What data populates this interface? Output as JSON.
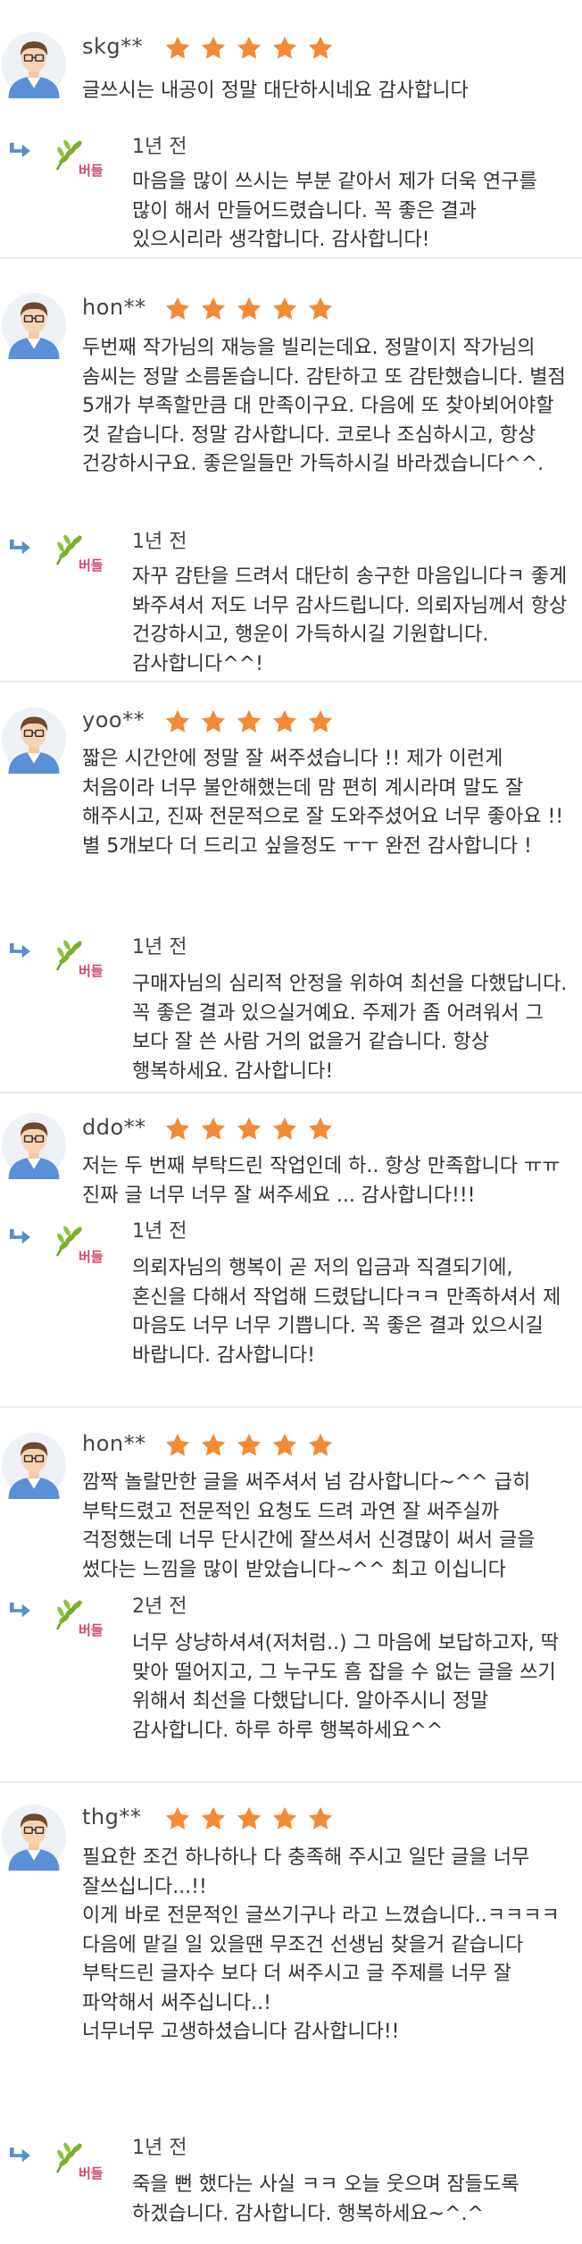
{
  "colors": {
    "star": "#f28a36",
    "seller_label": "#d4476b",
    "reply_arrow": "#5b8dd1",
    "divider": "#ececec"
  },
  "icons": {
    "avatar": "user-avatar-icon",
    "star": "star-icon",
    "reply": "reply-arrow-icon",
    "seller": "leaf-seller-icon"
  },
  "reviews": [
    {
      "user": "skg**",
      "rating": 5,
      "text": "글쓰시는 내공이 정말 대단하시네요 감사합니다",
      "reply_date": "1년 전",
      "seller_label": "버들",
      "reply": "마음을 많이 쓰시는 부분 같아서 제가 더욱 연구를 많이 해서 만들어드렸습니다. 꼭 좋은 결과 있으시리라 생각합니다. 감사합니다!"
    },
    {
      "user": "hon**",
      "rating": 5,
      "text": "두번째 작가님의 재능을 빌리는데요. 정말이지 작가님의 솜씨는 정말 소름돋습니다. 감탄하고 또 감탄했습니다. 별점 5개가 부족할만큼 대 만족이구요. 다음에 또 찾아뵈어야할 것 같습니다. 정말 감사합니다. 코로나 조심하시고, 항상 건강하시구요. 좋은일들만 가득하시길 바라겠습니다^^.",
      "reply_date": "1년 전",
      "seller_label": "버들",
      "reply": "자꾸 감탄을 드려서 대단히 송구한 마음입니다ㅋ 좋게 봐주셔서 저도 너무 감사드립니다. 의뢰자님께서 항상 건강하시고, 행운이 가득하시길 기원합니다. 감사합니다^^!"
    },
    {
      "user": "yoo**",
      "rating": 5,
      "text": "짧은 시간안에 정말 잘 써주셨습니다 !! 제가 이런게 처음이라 너무 불안해했는데 맘 편히 계시라며 말도 잘 해주시고, 진짜 전문적으로 잘 도와주셨어요 너무 좋아요 !! 별 5개보다 더 드리고 싶을정도 ㅜㅜ 완전 감사합니다 !",
      "reply_date": "1년 전",
      "seller_label": "버들",
      "reply": "구매자님의 심리적 안정을 위하여 최선을 다했답니다. 꼭 좋은 결과 있으실거예요. 주제가 좀 어려워서 그 보다 잘 쓴 사람 거의 없을거 같습니다. 항상 행복하세요. 감사합니다!"
    },
    {
      "user": "ddo**",
      "rating": 5,
      "text": "저는 두 번째 부탁드린 작업인데 하.. 항상 만족합니다 ㅠㅠ 진짜 글 너무 너무 잘 써주세요 ... 감사합니다!!!",
      "reply_date": "1년 전",
      "seller_label": "버들",
      "reply": "의뢰자님의 행복이 곧 저의 입금과 직결되기에, 혼신을 다해서 작업해 드렸답니다ㅋㅋ 만족하셔서 제 마음도 너무 너무 기쁩니다. 꼭 좋은 결과 있으시길 바랍니다. 감사합니다!"
    },
    {
      "user": "hon**",
      "rating": 5,
      "text": "깜짝 놀랄만한 글을 써주셔서 넘 감사합니다~^^ 급히 부탁드렸고 전문적인 요청도 드려 과연 잘 써주실까 걱정했는데 너무 단시간에 잘쓰셔서 신경많이 써서 글을 썼다는 느낌을 많이 받았습니다~^^ 최고 이십니다",
      "reply_date": "2년 전",
      "seller_label": "버들",
      "reply": "너무 상냥하셔셔(저처럼..) 그 마음에 보답하고자, 딱 맞아 떨어지고, 그 누구도 흠 잡을 수 없는 글을 쓰기 위해서 최선을 다했답니다. 알아주시니 정말 감사합니다. 하루 하루 행복하세요^^"
    },
    {
      "user": "thg**",
      "rating": 5,
      "text": "필요한 조건 하나하나 다 충족해 주시고 일단 글을 너무 잘쓰십니다...!!\n이게 바로 전문적인 글쓰기구나 라고 느꼈습니다..ㅋㅋㅋㅋ\n다음에 맡길 일 있을땐 무조건 선생님 찾을거 같습니다 부탁드린 글자수 보다 더 써주시고 글 주제를 너무 잘 파악해서 써주십니다..!\n너무너무 고생하셨습니다 감사합니다!!",
      "reply_date": "1년 전",
      "seller_label": "버들",
      "reply": "죽을 뻔 했다는 사실 ㅋㅋ 오늘 웃으며 잠들도록 하겠습니다. 감사합니다. 행복하세요~^.^"
    }
  ]
}
